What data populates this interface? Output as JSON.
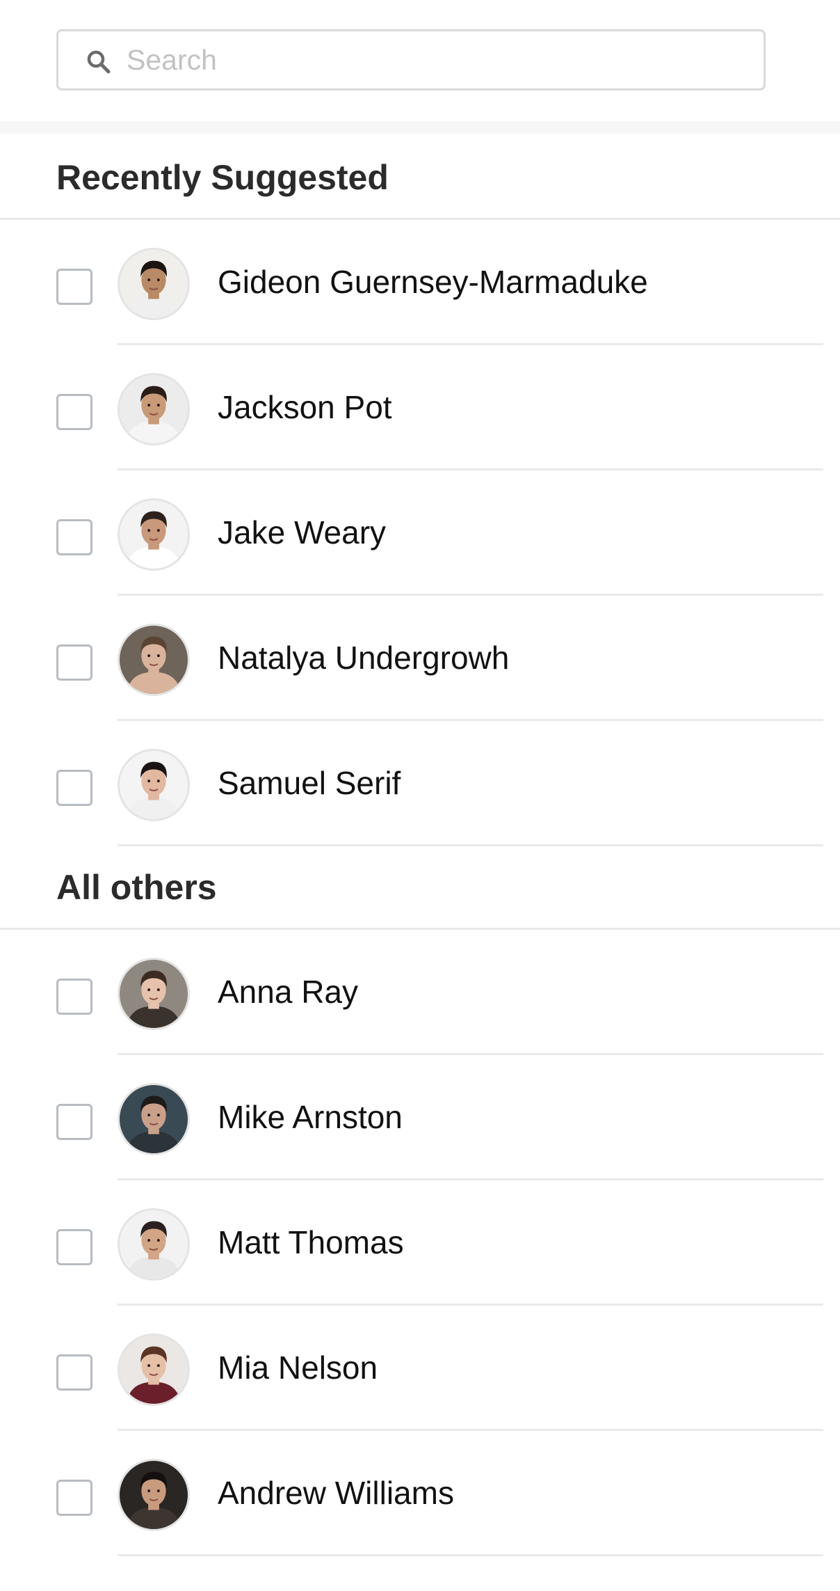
{
  "search": {
    "placeholder": "Search",
    "value": ""
  },
  "sections": [
    {
      "title": "Recently Suggested",
      "contacts": [
        {
          "name": "Gideon Guernsey-Marmaduke",
          "checked": false,
          "avatar": {
            "bg": "#f1efec",
            "skin": "#b98a66",
            "hair": "#1b1411",
            "shirt": "#efefef"
          }
        },
        {
          "name": "Jackson Pot",
          "checked": false,
          "avatar": {
            "bg": "#ececec",
            "skin": "#c99a78",
            "hair": "#2a1d17",
            "shirt": "#f5f5f5"
          }
        },
        {
          "name": "Jake Weary",
          "checked": false,
          "avatar": {
            "bg": "#f3f3f3",
            "skin": "#c8997a",
            "hair": "#2d211b",
            "shirt": "#ffffff"
          }
        },
        {
          "name": "Natalya Undergrowh",
          "checked": false,
          "avatar": {
            "bg": "#6e6459",
            "skin": "#d9b39c",
            "hair": "#5a4535",
            "shirt": "#d9b39c"
          }
        },
        {
          "name": "Samuel Serif",
          "checked": false,
          "avatar": {
            "bg": "#f4f4f4",
            "skin": "#e2b8a0",
            "hair": "#1a1414",
            "shirt": "#f0f0f0"
          }
        }
      ]
    },
    {
      "title": "All others",
      "contacts": [
        {
          "name": "Anna Ray",
          "checked": false,
          "avatar": {
            "bg": "#8e8880",
            "skin": "#e6c2ad",
            "hair": "#3b2b22",
            "shirt": "#3a332d"
          }
        },
        {
          "name": "Mike Arnston",
          "checked": false,
          "avatar": {
            "bg": "#3a4a55",
            "skin": "#c9a18b",
            "hair": "#1e1a18",
            "shirt": "#2c3339"
          }
        },
        {
          "name": "Matt Thomas",
          "checked": false,
          "avatar": {
            "bg": "#f2f2f2",
            "skin": "#d2a586",
            "hair": "#2a2020",
            "shirt": "#e8e8e8"
          }
        },
        {
          "name": "Mia Nelson",
          "checked": false,
          "avatar": {
            "bg": "#eae7e5",
            "skin": "#e5bfa6",
            "hair": "#5b3426",
            "shirt": "#6b1f2a"
          }
        },
        {
          "name": "Andrew Williams",
          "checked": false,
          "avatar": {
            "bg": "#2a2624",
            "skin": "#c99b7e",
            "hair": "#141010",
            "shirt": "#3d3530"
          }
        }
      ]
    }
  ]
}
